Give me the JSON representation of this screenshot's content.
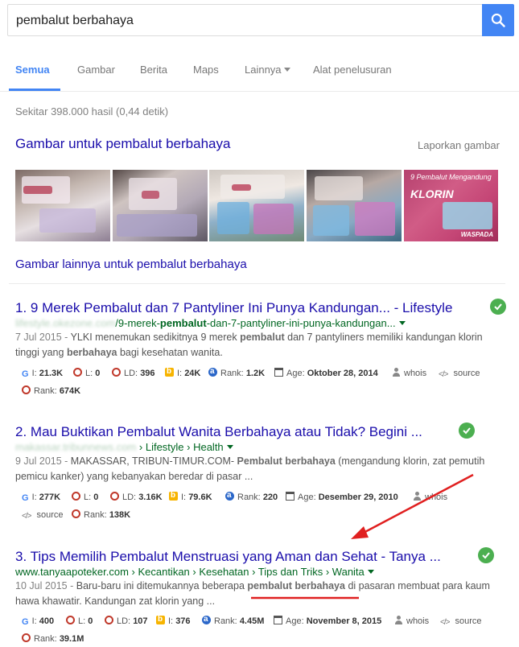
{
  "search": {
    "query": "pembalut berbahaya"
  },
  "tabs": {
    "items": [
      "Semua",
      "Gambar",
      "Berita",
      "Maps",
      "Lainnya",
      "Alat penelusuran"
    ]
  },
  "stats": "Sekitar 398.000 hasil (0,44 detik)",
  "images": {
    "heading": "Gambar untuk pembalut berbahaya",
    "report": "Laporkan gambar",
    "more": "Gambar lainnya untuk pembalut berbahaya",
    "thumb5_title": "9 Pembalut Mengandung",
    "thumb5_main": "KLORIN",
    "thumb5_footer": "WASPADA"
  },
  "results": [
    {
      "num": "1.",
      "title": "9 Merek Pembalut dan 7 Pantyliner Ini Punya Kandungan... - Lifestyle",
      "url_blur": "lifestyle.okezone.com",
      "url_a": "/9-merek-",
      "url_b": "pembalut",
      "url_c": "-dan-7-pantyliner-ini-punya-kandungan...",
      "date": "7 Jul 2015 -",
      "snip_a": " YLKI menemukan sedikitnya 9 merek ",
      "snip_b": "pembalut",
      "snip_c": " dan 7 pantyliners memiliki kandungan klorin tinggi yang ",
      "snip_d": "berbahaya",
      "snip_e": " bagi kesehatan wanita.",
      "seo": {
        "g": "I:",
        "g_val": "21.3K",
        "l": "L:",
        "l_val": "0",
        "ld": "LD:",
        "ld_val": "396",
        "b": "I:",
        "b_val": "24K",
        "rank": "Rank:",
        "rank_val": "1.2K",
        "age": "Age:",
        "age_val": "Oktober 28, 2014",
        "whois": "whois",
        "source": "source",
        "rank2": "Rank:",
        "rank2_val": "674K"
      }
    },
    {
      "num": "2.",
      "title": "Mau Buktikan Pembalut Wanita Berbahaya atau Tidak? Begini ...",
      "url_blur": "makassar.tribunnews.com",
      "url_a": " › Lifestyle › Health",
      "date": "9 Jul 2015 -",
      "snip_a": " MAKASSAR, TRIBUN-TIMUR.COM- ",
      "snip_b": "Pembalut berbahaya",
      "snip_c": " (mengandung klorin, zat pemutih pemicu kanker) yang kebanyakan beredar di pasar ...",
      "seo": {
        "g": "I:",
        "g_val": "277K",
        "l": "L:",
        "l_val": "0",
        "ld": "LD:",
        "ld_val": "3.16K",
        "b": "I:",
        "b_val": "79.6K",
        "rank": "Rank:",
        "rank_val": "220",
        "age": "Age:",
        "age_val": "Desember 29, 2010",
        "whois": "whois",
        "source": "source",
        "rank2": "Rank:",
        "rank2_val": "138K"
      }
    },
    {
      "num": "3.",
      "title": "Tips Memilih Pembalut Menstruasi yang Aman dan Sehat - Tanya ...",
      "url_a": "www.tanyaapoteker.com › Kecantikan › Kesehatan › Tips dan Triks › Wanita",
      "date": "10 Jul 2015 -",
      "snip_a": " Baru-baru ini ditemukannya beberapa ",
      "snip_b": "pembalut berbahaya",
      "snip_c": " di pasaran membuat para kaum hawa khawatir. Kandungan zat klorin yang ...",
      "seo": {
        "g": "I:",
        "g_val": "400",
        "l": "L:",
        "l_val": "0",
        "ld": "LD:",
        "ld_val": "107",
        "b": "I:",
        "b_val": "376",
        "rank": "Rank:",
        "rank_val": "4.45M",
        "age": "Age:",
        "age_val": "November 8, 2015",
        "whois": "whois",
        "source": "source",
        "rank2": "Rank:",
        "rank2_val": "39.1M"
      }
    }
  ],
  "colors": {
    "link": "#1a0dab",
    "url": "#006621",
    "accent": "#4285f4",
    "check": "#4caf50",
    "annotation": "#e02020"
  }
}
